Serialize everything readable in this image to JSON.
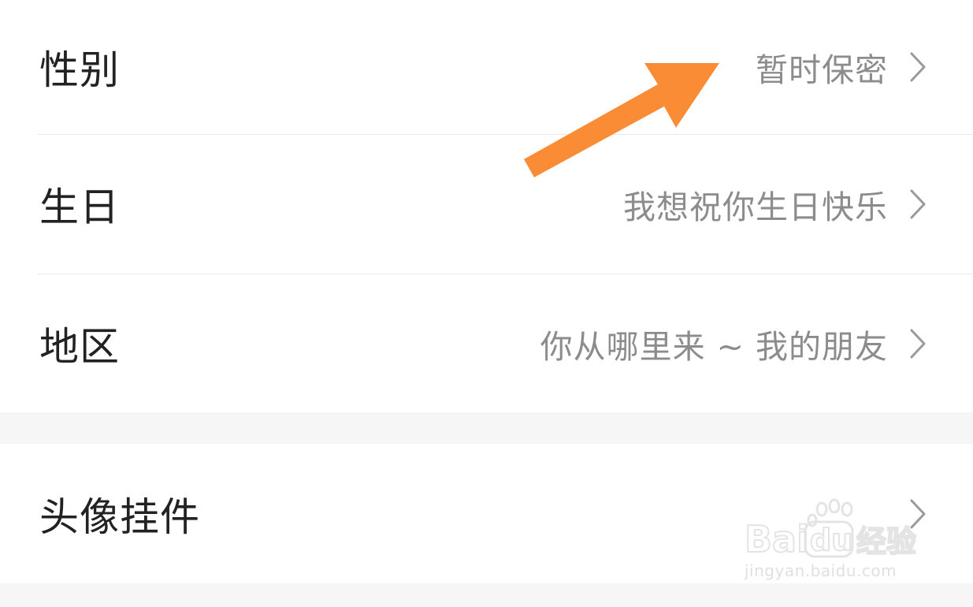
{
  "rows": {
    "gender": {
      "label": "性别",
      "value": "暂时保密"
    },
    "birthday": {
      "label": "生日",
      "value": "我想祝你生日快乐"
    },
    "region": {
      "label": "地区",
      "value": "你从哪里来 ~ 我的朋友"
    },
    "pendant": {
      "label": "头像挂件",
      "value": ""
    }
  },
  "icons": {
    "row_chevron": "chevron-right-icon",
    "annotation": "arrow-icon"
  },
  "colors": {
    "label": "#222222",
    "value": "#8c8c8c",
    "chevron": "#9a9a9a",
    "background": "#f6f6f6",
    "card": "#ffffff",
    "divider": "#e9e9e9",
    "annotation_arrow": "#fb8c36"
  },
  "watermark": {
    "logo_text": "Baidu经验",
    "url": "jingyan.baidu.com"
  }
}
